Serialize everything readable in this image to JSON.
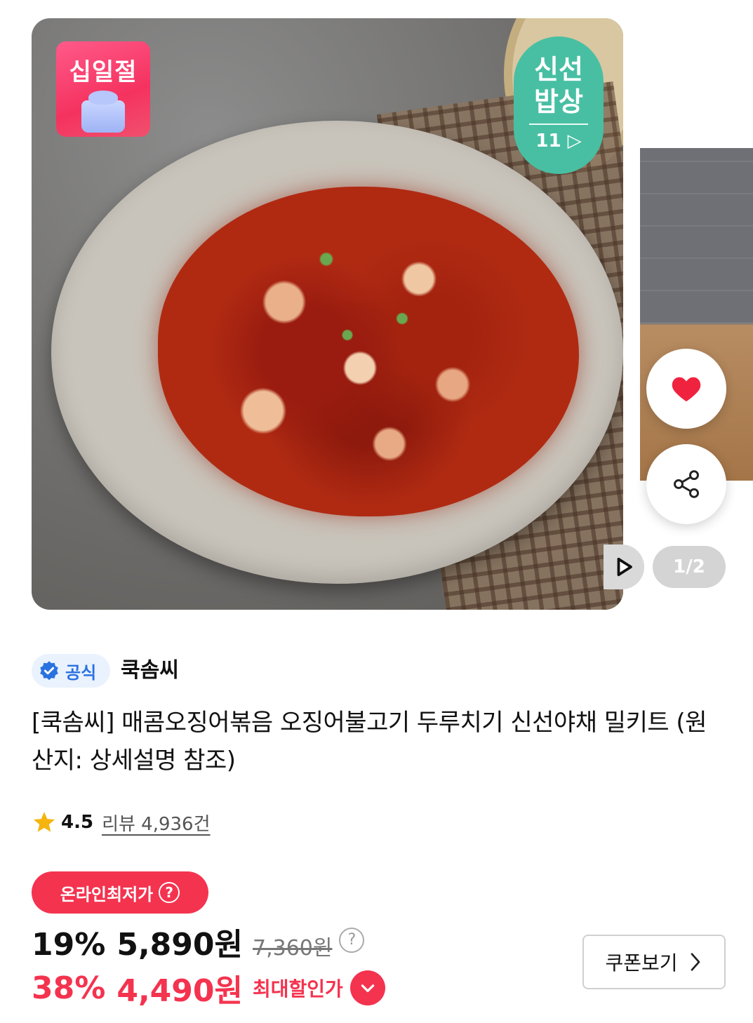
{
  "gallery": {
    "badge_left": "십일절",
    "badge_right_line1": "신선",
    "badge_right_line2": "밥상",
    "badge_right_number": "11",
    "page_indicator": "1/2"
  },
  "seller": {
    "official_label": "공식",
    "name": "쿡솜씨"
  },
  "product": {
    "title": "[쿡솜씨] 매콤오징어볶음 오징어불고기 두루치기 신선야채 밀키트 (원산지: 상세설명 참조)"
  },
  "rating": {
    "value": "4.5",
    "review_text": "리뷰 4,936건"
  },
  "price": {
    "lowest_badge": "온라인최저가",
    "discount_rate": "19%",
    "sale_price": "5,890원",
    "original_price": "7,360원",
    "max_discount_rate": "38%",
    "max_price": "4,490원",
    "max_price_label": "최대할인가",
    "coupon_button": "쿠폰보기"
  },
  "icons": {
    "wish": "heart-icon",
    "share": "share-icon",
    "play": "play-icon",
    "verified": "verified-check-icon",
    "star": "star-icon"
  },
  "colors": {
    "accent_red": "#f4334f",
    "fresh_green": "#48bfa3",
    "official_blue": "#2a72e0"
  }
}
